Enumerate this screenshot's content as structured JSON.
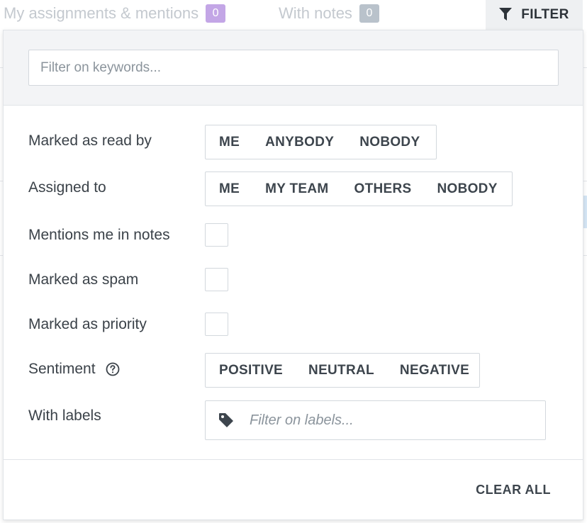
{
  "tabs": [
    {
      "label": "My assignments & mentions",
      "count": "0",
      "badge_color": "#c3a6e6"
    },
    {
      "label": "With notes",
      "count": "0",
      "badge_color": "#b9c2cb"
    }
  ],
  "filter_button": {
    "label": "FILTER",
    "icon": "funnel-icon"
  },
  "keyword_filter": {
    "placeholder": "Filter on keywords...",
    "value": ""
  },
  "rows": {
    "read_by": {
      "label": "Marked as read by",
      "options": [
        "ME",
        "ANYBODY",
        "NOBODY"
      ]
    },
    "assigned_to": {
      "label": "Assigned to",
      "options": [
        "ME",
        "MY TEAM",
        "OTHERS",
        "NOBODY"
      ]
    },
    "mentions": {
      "label": "Mentions me in notes",
      "checked": false
    },
    "spam": {
      "label": "Marked as spam",
      "checked": false
    },
    "priority": {
      "label": "Marked as priority",
      "checked": false
    },
    "sentiment": {
      "label": "Sentiment",
      "options": [
        "POSITIVE",
        "NEUTRAL",
        "NEGATIVE"
      ],
      "help_icon": "question-circle-icon"
    },
    "labels": {
      "label": "With labels",
      "placeholder": "Filter on labels...",
      "icon": "tag-icon"
    }
  },
  "footer": {
    "clear_all": "CLEAR ALL"
  },
  "colors": {
    "text": "#3b4249",
    "border": "#d3d8dd",
    "header_bg": "#f3f4f6"
  }
}
